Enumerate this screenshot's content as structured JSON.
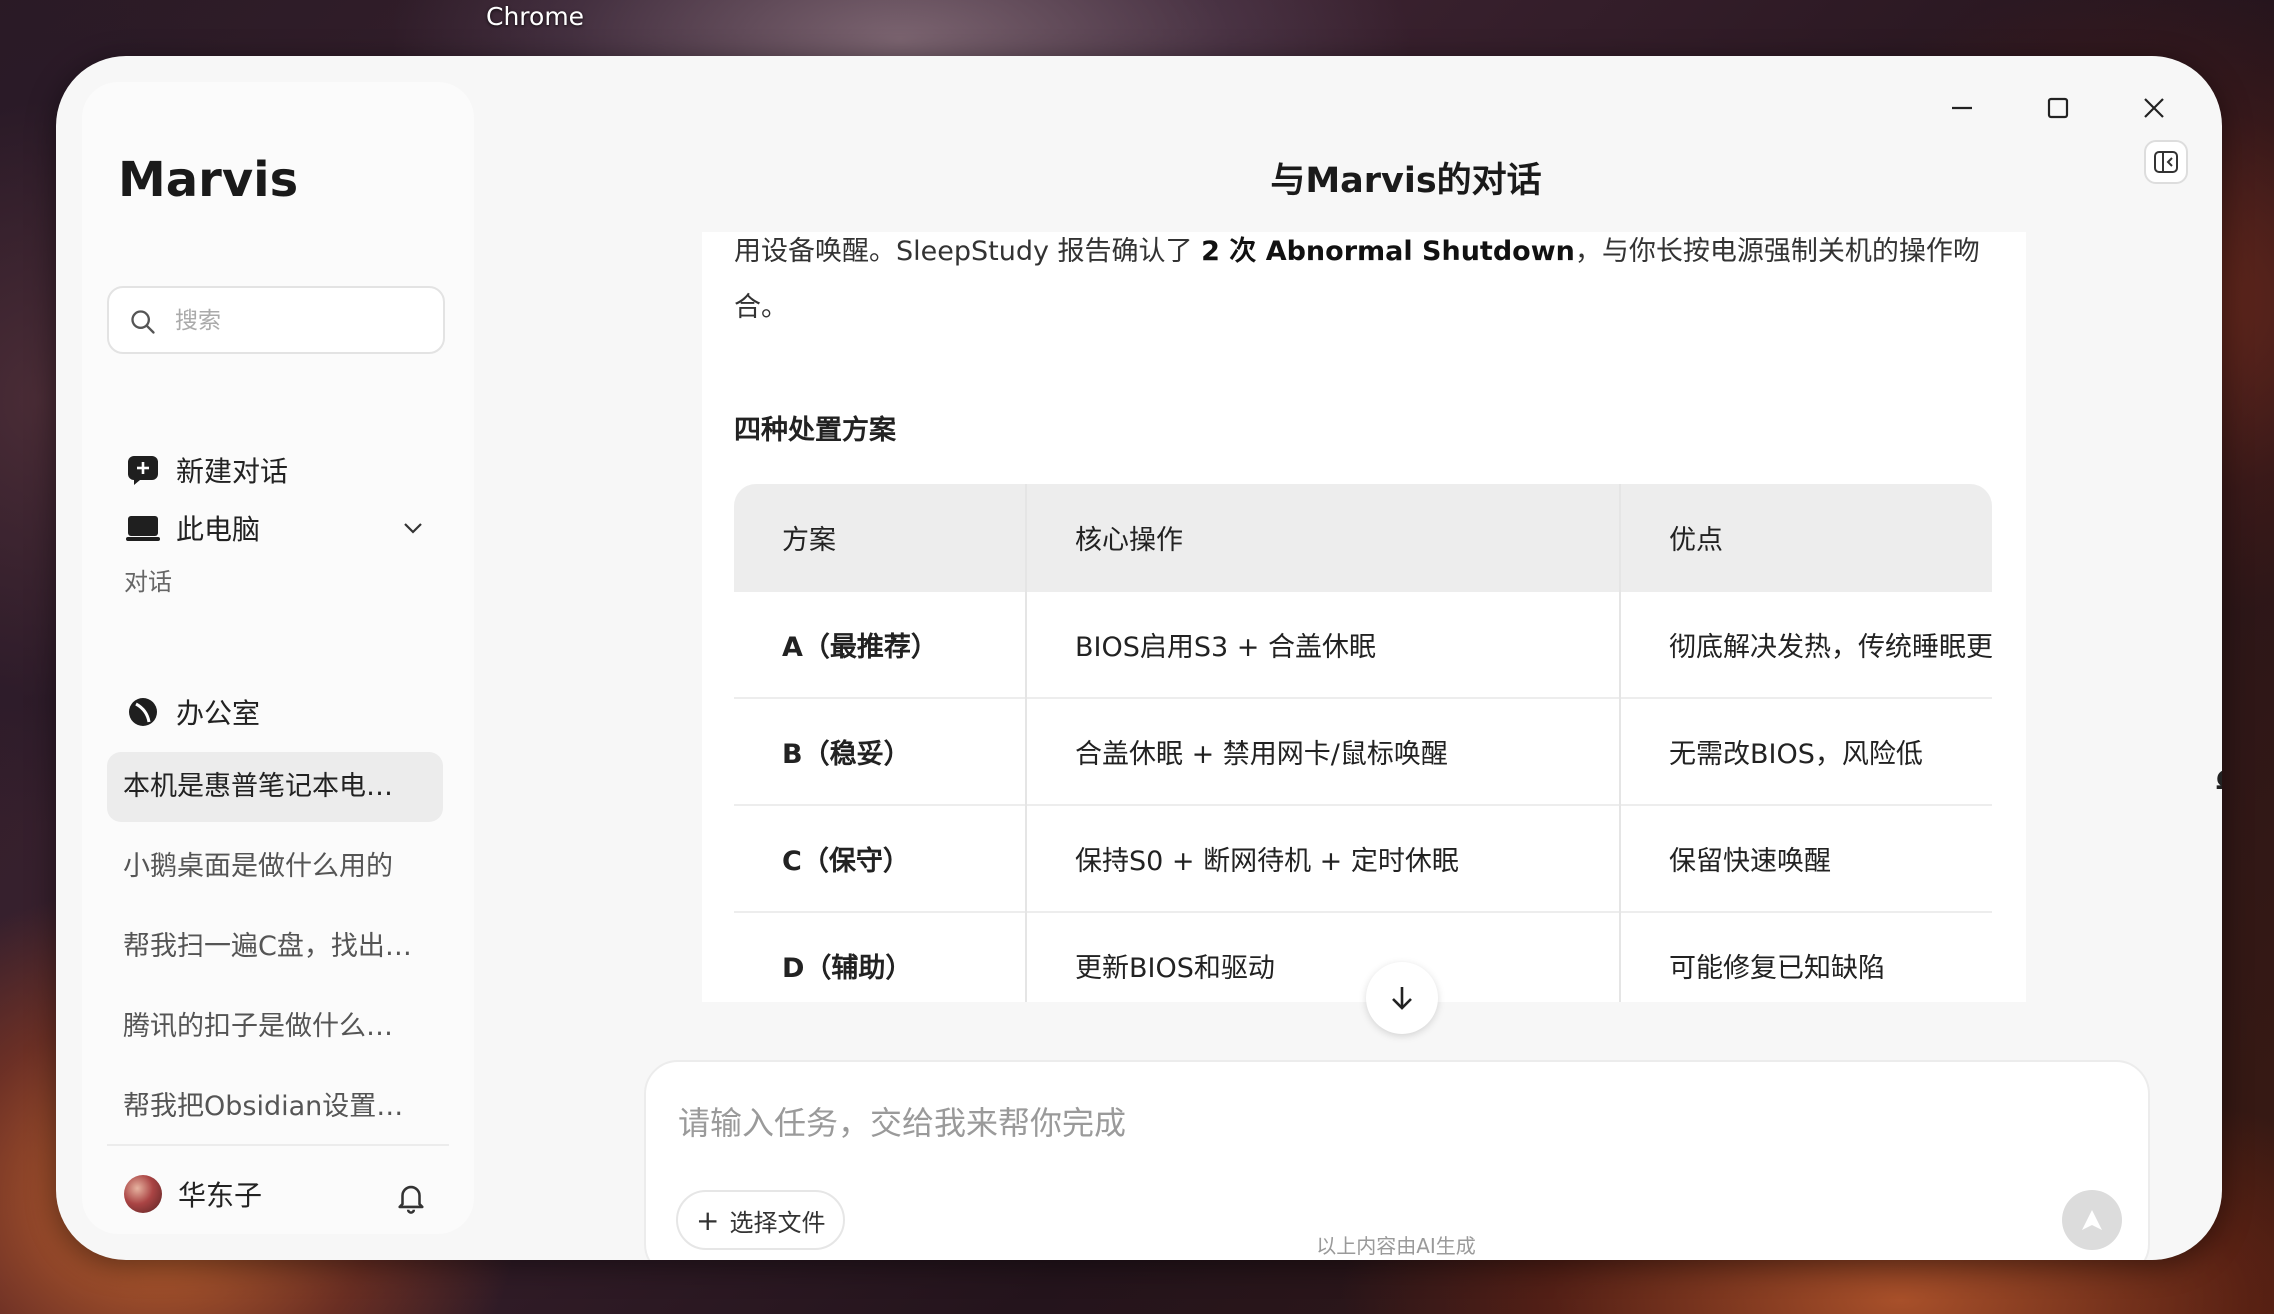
{
  "desktop": {
    "taskbar_label": "Chrome"
  },
  "sidebar": {
    "brand": "Marvis",
    "search_placeholder": "搜索",
    "new_chat": "新建对话",
    "device": "此电脑",
    "section_label": "对话",
    "workspace": "办公室",
    "conversations": [
      "本机是惠普笔记本电…",
      "小鹅桌面是做什么用的",
      "帮我扫一遍C盘，找出…",
      "腾讯的扣子是做什么…",
      "帮我把Obsidian设置…"
    ],
    "user_name": "华东子"
  },
  "header": {
    "title": "与Marvis的对话"
  },
  "message": {
    "para_line1_pre": "用设备唤醒。SleepStudy 报告确认了 ",
    "para_line1_bold": "2 次 Abnormal Shutdown",
    "para_line1_post": "，与你长按电源强制关机的操作吻",
    "para_line2": "合。",
    "heading": "四种处置方案",
    "table": {
      "headers": [
        "方案",
        "核心操作",
        "优点"
      ],
      "rows": [
        [
          "A（最推荐）",
          "BIOS启用S3 + 合盖休眠",
          "彻底解决发热，传统睡眠更"
        ],
        [
          "B（稳妥）",
          "合盖休眠 + 禁用网卡/鼠标唤醒",
          "无需改BIOS，风险低"
        ],
        [
          "C（保守）",
          "保持S0 + 断网待机 + 定时休眠",
          "保留快速唤醒"
        ],
        [
          "D（辅助）",
          "更新BIOS和驱动",
          "可能修复已知缺陷"
        ]
      ]
    }
  },
  "composer": {
    "placeholder": "请输入任务，交给我来帮你完成",
    "file_button": "选择文件",
    "disclaimer": "以上内容由AI生成"
  },
  "right_rail": {
    "glyph": "Ω"
  }
}
